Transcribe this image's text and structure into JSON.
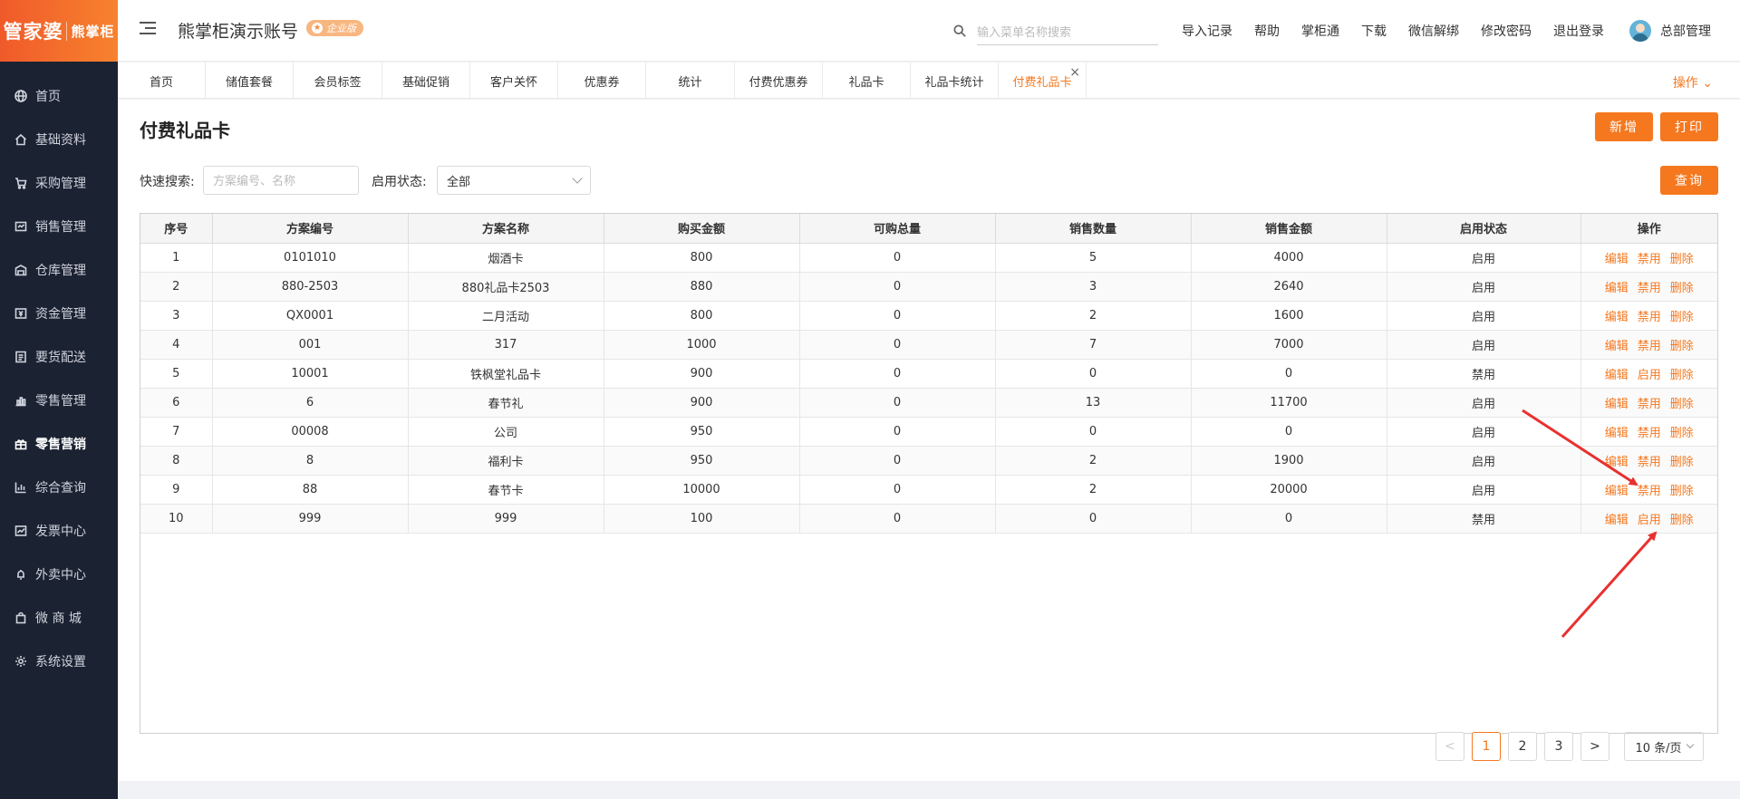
{
  "brand": {
    "name1": "管家婆",
    "name2": "熊掌柜"
  },
  "sidebar": {
    "items": [
      {
        "label": "首页",
        "icon": "globe-icon"
      },
      {
        "label": "基础资料",
        "icon": "home-icon"
      },
      {
        "label": "采购管理",
        "icon": "cart-icon"
      },
      {
        "label": "销售管理",
        "icon": "sales-icon"
      },
      {
        "label": "仓库管理",
        "icon": "warehouse-icon"
      },
      {
        "label": "资金管理",
        "icon": "money-icon"
      },
      {
        "label": "要货配送",
        "icon": "list-icon"
      },
      {
        "label": "零售管理",
        "icon": "chart-icon"
      },
      {
        "label": "零售营销",
        "icon": "gift-icon"
      },
      {
        "label": "综合查询",
        "icon": "bar-chart-icon"
      },
      {
        "label": "发票中心",
        "icon": "invoice-icon"
      },
      {
        "label": "外卖中心",
        "icon": "bell-icon"
      },
      {
        "label": "微 商 城",
        "icon": "shop-icon"
      },
      {
        "label": "系统设置",
        "icon": "gear-icon"
      }
    ],
    "active_index": 8
  },
  "header": {
    "account": "熊掌柜演示账号",
    "edition": "企业版",
    "search_placeholder": "输入菜单名称搜索",
    "links": [
      "导入记录",
      "帮助",
      "掌柜通",
      "下载",
      "微信解绑",
      "修改密码",
      "退出登录"
    ],
    "user": "总部管理"
  },
  "tabs": {
    "items": [
      "首页",
      "储值套餐",
      "会员标签",
      "基础促销",
      "客户关怀",
      "优惠券",
      "统计",
      "付费优惠券",
      "礼品卡",
      "礼品卡统计",
      "付费礼品卡"
    ],
    "active_index": 10,
    "close": "×",
    "ops": "操作"
  },
  "page": {
    "title": "付费礼品卡",
    "add_label": "新增",
    "print_label": "打印",
    "query_label": "查询",
    "quick_search_label": "快速搜索:",
    "quick_search_placeholder": "方案编号、名称",
    "status_label": "启用状态:",
    "status_value": "全部"
  },
  "table": {
    "headers": [
      "序号",
      "方案编号",
      "方案名称",
      "购买金额",
      "可购总量",
      "销售数量",
      "销售金额",
      "启用状态",
      "操作"
    ],
    "rows": [
      {
        "no": "1",
        "code": "0101010",
        "name": "烟酒卡",
        "price": "800",
        "total": "0",
        "sold": "5",
        "amount": "4000",
        "status": "启用",
        "ops": [
          "编辑",
          "禁用",
          "删除"
        ]
      },
      {
        "no": "2",
        "code": "880-2503",
        "name": "880礼品卡2503",
        "price": "880",
        "total": "0",
        "sold": "3",
        "amount": "2640",
        "status": "启用",
        "ops": [
          "编辑",
          "禁用",
          "删除"
        ]
      },
      {
        "no": "3",
        "code": "QX0001",
        "name": "二月活动",
        "price": "800",
        "total": "0",
        "sold": "2",
        "amount": "1600",
        "status": "启用",
        "ops": [
          "编辑",
          "禁用",
          "删除"
        ]
      },
      {
        "no": "4",
        "code": "001",
        "name": "317",
        "price": "1000",
        "total": "0",
        "sold": "7",
        "amount": "7000",
        "status": "启用",
        "ops": [
          "编辑",
          "禁用",
          "删除"
        ]
      },
      {
        "no": "5",
        "code": "10001",
        "name": "铁枫堂礼品卡",
        "price": "900",
        "total": "0",
        "sold": "0",
        "amount": "0",
        "status": "禁用",
        "ops": [
          "编辑",
          "启用",
          "删除"
        ]
      },
      {
        "no": "6",
        "code": "6",
        "name": "春节礼",
        "price": "900",
        "total": "0",
        "sold": "13",
        "amount": "11700",
        "status": "启用",
        "ops": [
          "编辑",
          "禁用",
          "删除"
        ]
      },
      {
        "no": "7",
        "code": "00008",
        "name": "公司",
        "price": "950",
        "total": "0",
        "sold": "0",
        "amount": "0",
        "status": "启用",
        "ops": [
          "编辑",
          "禁用",
          "删除"
        ]
      },
      {
        "no": "8",
        "code": "8",
        "name": "福利卡",
        "price": "950",
        "total": "0",
        "sold": "2",
        "amount": "1900",
        "status": "启用",
        "ops": [
          "编辑",
          "禁用",
          "删除"
        ]
      },
      {
        "no": "9",
        "code": "88",
        "name": "春节卡",
        "price": "10000",
        "total": "0",
        "sold": "2",
        "amount": "20000",
        "status": "启用",
        "ops": [
          "编辑",
          "禁用",
          "删除"
        ]
      },
      {
        "no": "10",
        "code": "999",
        "name": "999",
        "price": "100",
        "total": "0",
        "sold": "0",
        "amount": "0",
        "status": "禁用",
        "ops": [
          "编辑",
          "启用",
          "删除"
        ]
      }
    ]
  },
  "pagination": {
    "prev": "<",
    "pages": [
      "1",
      "2",
      "3"
    ],
    "current": "1",
    "next": ">",
    "page_size": "10 条/页"
  },
  "colors": {
    "accent": "#f5781f",
    "sidebar_bg": "#1b2232",
    "annotation_arrow": "#e8312f"
  }
}
